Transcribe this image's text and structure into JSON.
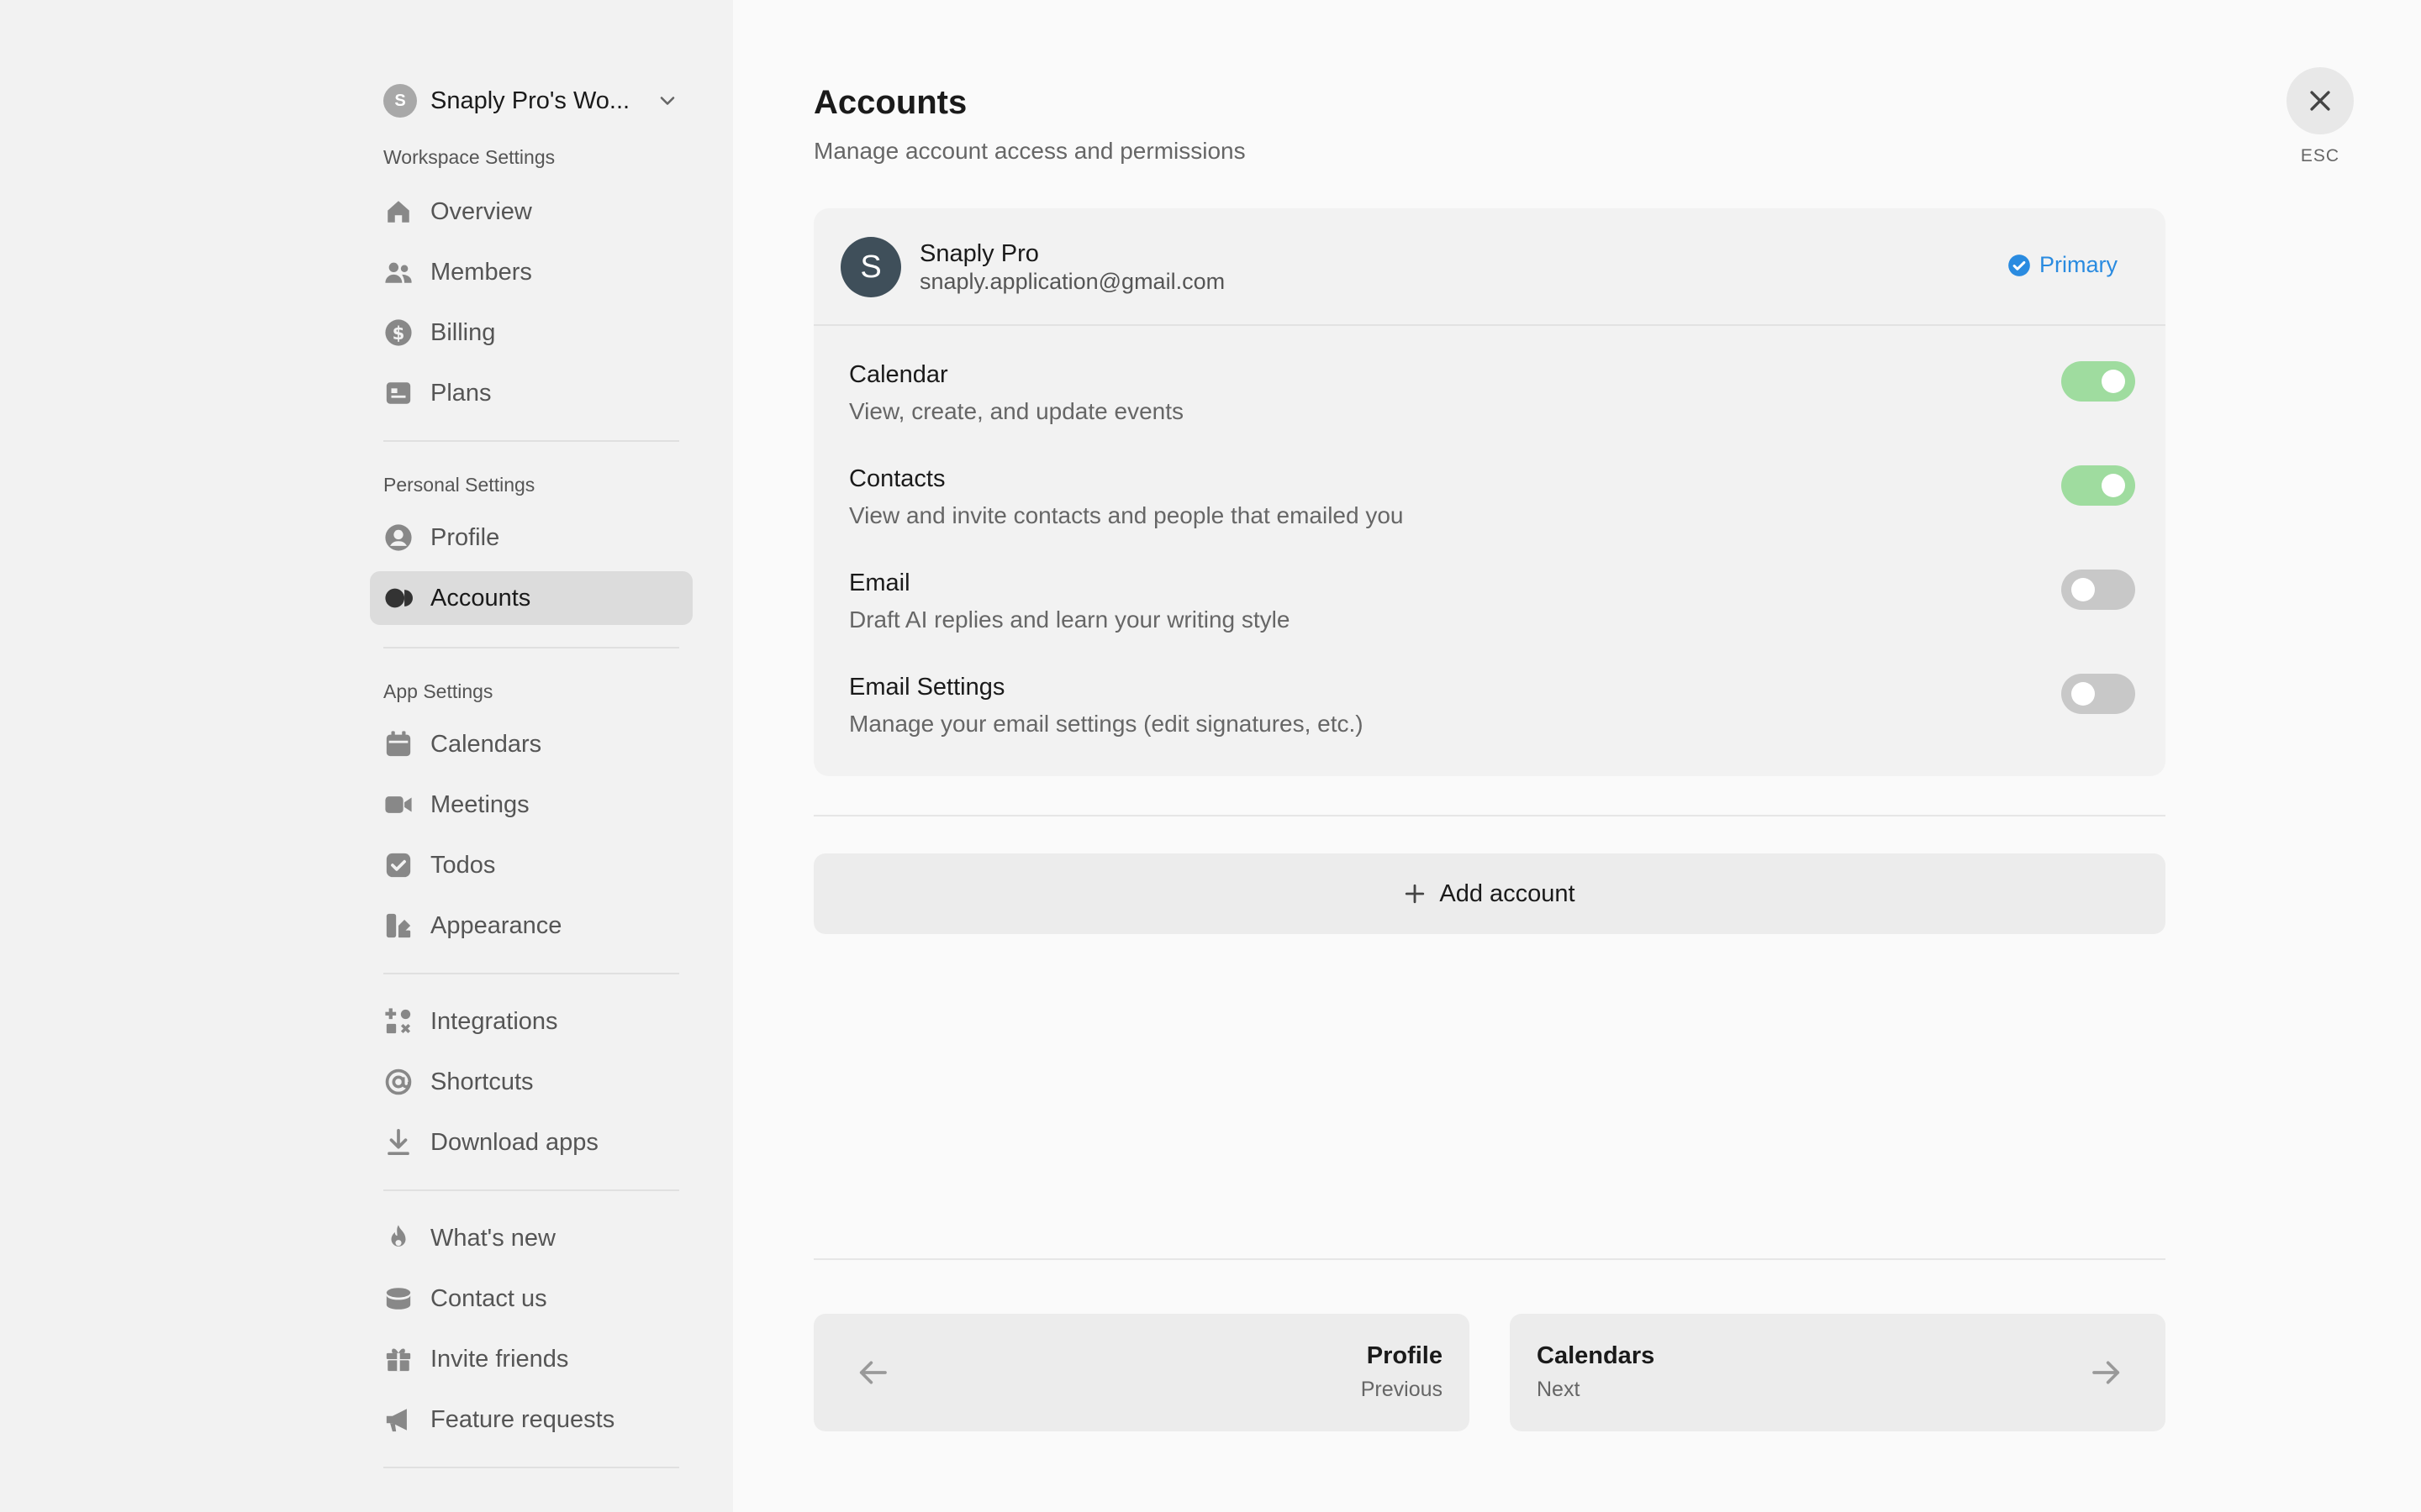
{
  "sidebar": {
    "workspace": {
      "avatar_letter": "S",
      "name": "Snaply Pro's Wo..."
    },
    "sections": {
      "workspace_label": "Workspace Settings",
      "personal_label": "Personal Settings",
      "app_label": "App Settings"
    },
    "items": {
      "overview": "Overview",
      "members": "Members",
      "billing": "Billing",
      "plans": "Plans",
      "profile": "Profile",
      "accounts": "Accounts",
      "calendars": "Calendars",
      "meetings": "Meetings",
      "todos": "Todos",
      "appearance": "Appearance",
      "integrations": "Integrations",
      "shortcuts": "Shortcuts",
      "download_apps": "Download apps",
      "whats_new": "What's new",
      "contact_us": "Contact us",
      "invite_friends": "Invite friends",
      "feature_requests": "Feature requests"
    },
    "active_item": "Accounts"
  },
  "main": {
    "title": "Accounts",
    "subtitle": "Manage account access and permissions",
    "close_label": "ESC",
    "account": {
      "avatar_letter": "S",
      "name": "Snaply Pro",
      "email": "snaply.application@gmail.com",
      "badge": "Primary",
      "permissions": [
        {
          "title": "Calendar",
          "description": "View, create, and update events",
          "enabled": true
        },
        {
          "title": "Contacts",
          "description": "View and invite contacts and people that emailed you",
          "enabled": true
        },
        {
          "title": "Email",
          "description": "Draft AI replies and learn your writing style",
          "enabled": false
        },
        {
          "title": "Email Settings",
          "description": "Manage your email settings (edit signatures, etc.)",
          "enabled": false
        }
      ]
    },
    "add_account_label": "Add account",
    "pager": {
      "prev": {
        "title": "Profile",
        "sub": "Previous"
      },
      "next": {
        "title": "Calendars",
        "sub": "Next"
      }
    }
  },
  "colors": {
    "toggle_on": "#9fdc9f",
    "toggle_off": "#c8c8c8",
    "primary_badge": "#2a8be0",
    "account_avatar": "#3f4f5a",
    "logout": "#e0443a"
  }
}
